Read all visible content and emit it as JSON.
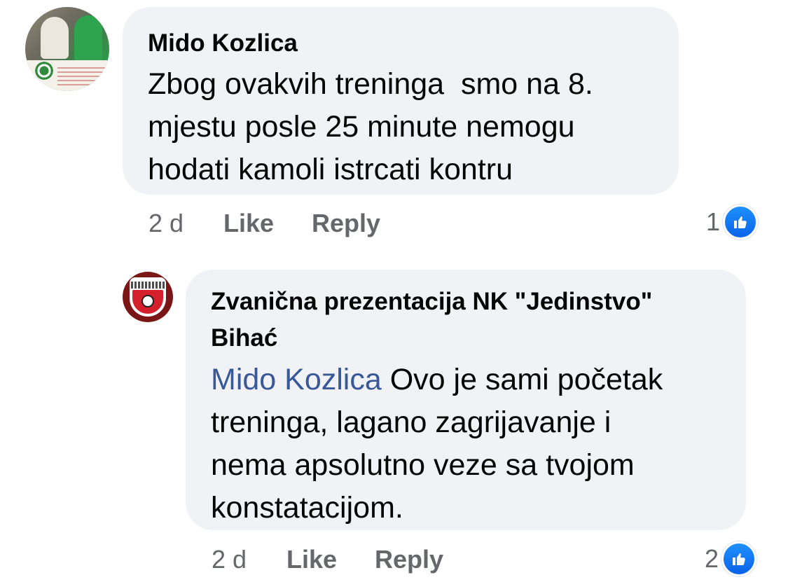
{
  "comments": [
    {
      "author": "Mido Kozlica",
      "text": "Zbog ovakvih treninga  smo na 8. mjestu posle 25 minute nemogu hodati kamoli istrcati kontru",
      "time": "2 d",
      "like_label": "Like",
      "reply_label": "Reply",
      "reaction_count": "1",
      "avatar_icon": "profile-photo-couple"
    },
    {
      "author_line1": "Zvanična prezentacija NK \"Jedinstvo\"",
      "author_line2": "Bihać",
      "mention": "Mido Kozlica",
      "text_line1": " Ovo je sami početak",
      "text_rest": "treninga, lagano zagrijavanje i nema apsolutno veze sa tvojom konstatacijom.",
      "time": "2 d",
      "like_label": "Like",
      "reply_label": "Reply",
      "reaction_count": "2",
      "avatar_icon": "club-crest"
    }
  ],
  "colors": {
    "bubble": "#f0f2f5",
    "mention": "#385898",
    "meta": "#65676b",
    "like_badge": "#1877f2"
  }
}
